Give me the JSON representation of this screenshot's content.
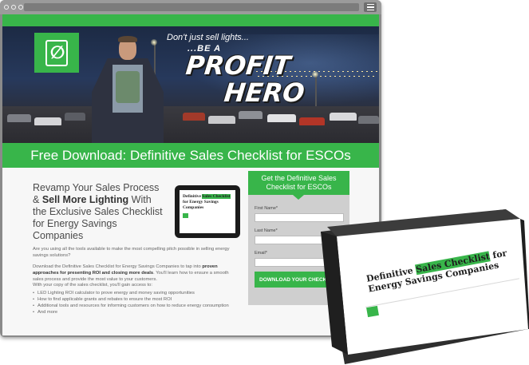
{
  "hero": {
    "tagline_1": "Don't just sell lights...",
    "tagline_2": "...BE A",
    "tagline_3": "PROFIT",
    "tagline_4": "HERO"
  },
  "banner": {
    "title": "Free Download: Definitive Sales Checklist for ESCOs"
  },
  "main": {
    "headline_1": "Revamp Your Sales Process &",
    "headline_2": "Sell More Lighting",
    "headline_3": "With the Exclusive Sales Checklist for Energy Savings Companies",
    "paragraph_1": "Are you using all the tools available to make the most compelling pitch possible in selling energy savings solutions?",
    "paragraph_2_a": "Download the Definitive Sales Checklist for Energy Savings Companies to tap into",
    "paragraph_2_b": "proven approaches for presenting ROI and closing more deals",
    "paragraph_2_c": ". You'll learn how to ensure a smooth sales process and provide the most value to your customers.",
    "paragraph_3": "With your copy of the sales checklist, you'll gain access to:",
    "bullets": [
      "LED Lighting ROI calculator to prove energy and money saving opportunities",
      "How to find applicable grants and rebates to ensure the most ROI",
      "Additional tools and resources for informing customers on how to reduce energy consumption",
      "And more"
    ]
  },
  "tablet": {
    "title_a": "Definitive",
    "title_hl": "Sales Checklist",
    "title_b": "for Energy Savings Companies"
  },
  "form": {
    "heading": "Get the Definitive Sales Checklist for ESCOs",
    "first_name_label": "First Name*",
    "last_name_label": "Last Name*",
    "email_label": "Email*",
    "submit_label": "DOWNLOAD YOUR CHECKLIST"
  },
  "book": {
    "title_a": "Definitive",
    "title_hl": "Sales Checklist",
    "title_b": "for",
    "title_c": "Energy Savings Companies"
  },
  "colors": {
    "brand_green": "#38b54a",
    "frame_gray": "#8a8a8a"
  }
}
